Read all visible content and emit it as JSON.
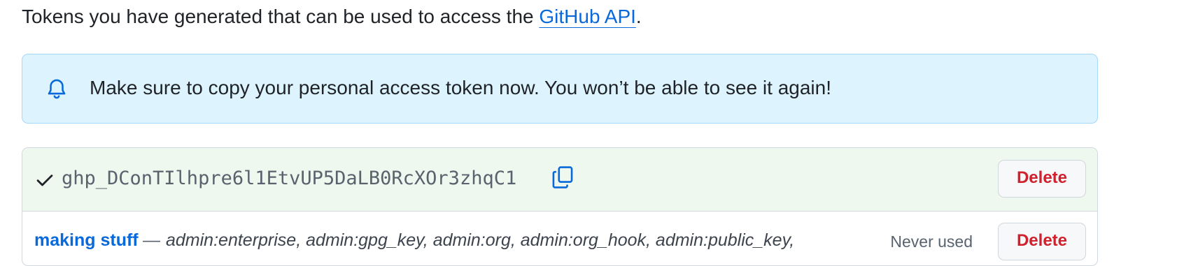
{
  "intro": {
    "text_before": "Tokens you have generated that can be used to access the ",
    "link_text": "GitHub API",
    "text_after": "."
  },
  "flash": {
    "icon": "bell-icon",
    "message": "Make sure to copy your personal access token now. You won’t be able to see it again!"
  },
  "new_token": {
    "icon": "check-icon",
    "value": "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",
    "copy_icon": "copy-icon",
    "delete_label": "Delete"
  },
  "existing_token": {
    "name": "making stuff",
    "separator": "—",
    "scopes": "admin:enterprise, admin:gpg_key, admin:org, admin:org_hook, admin:public_key,",
    "last_used": "Never used",
    "delete_label": "Delete"
  },
  "colors": {
    "link": "#0969da",
    "flash_bg": "#ddf4ff",
    "flash_border": "#a6d8fb",
    "new_token_bg": "#eef8ef",
    "danger": "#cf222e"
  }
}
